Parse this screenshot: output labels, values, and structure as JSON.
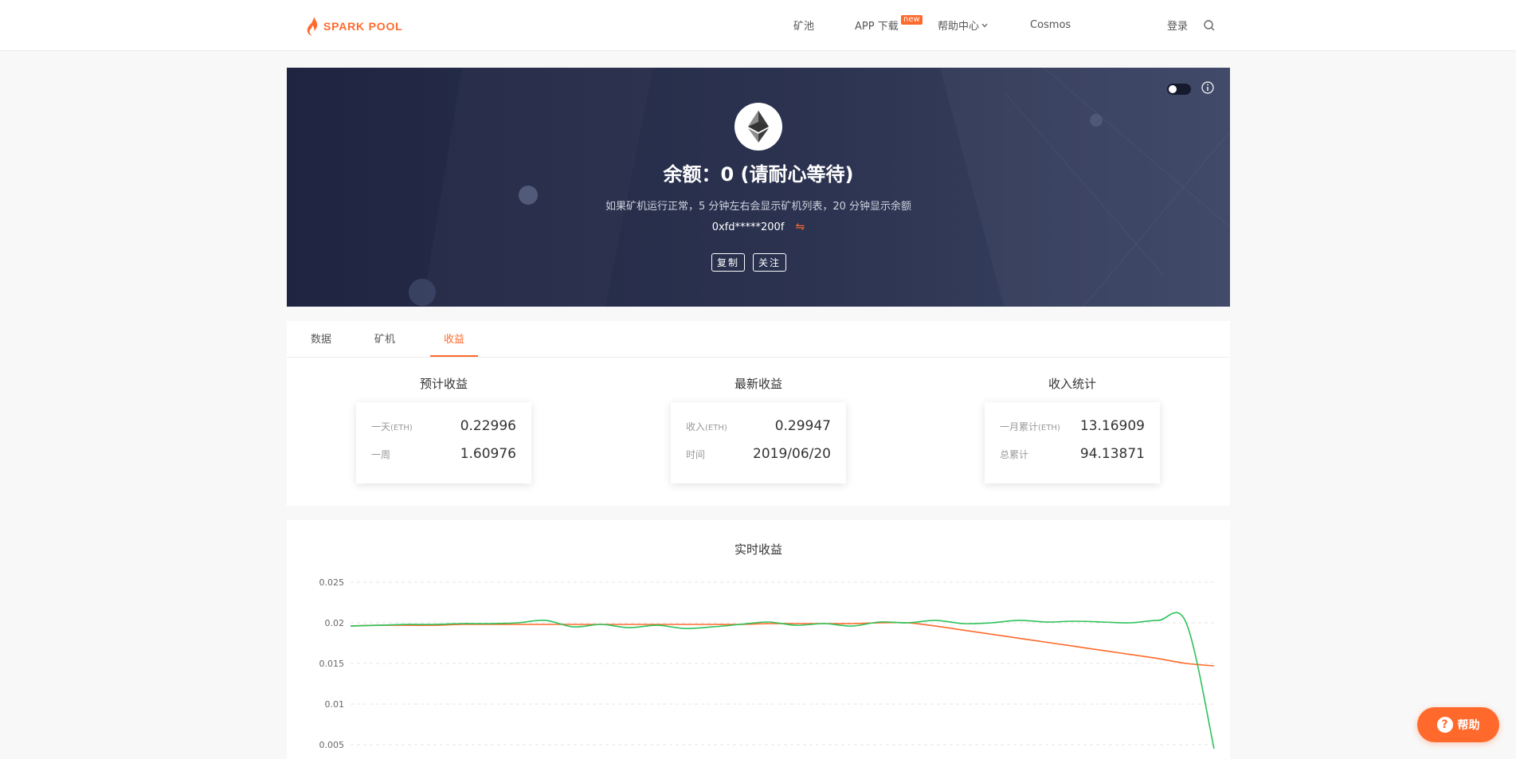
{
  "header": {
    "logo_text": "SPARK POOL",
    "nav": {
      "pool": "矿池",
      "app": "APP 下载",
      "app_badge": "new",
      "help": "帮助中心",
      "cosmos": "Cosmos",
      "login": "登录"
    }
  },
  "banner": {
    "balance": "余额：0 (请耐心等待)",
    "hint": "如果矿机运行正常，5 分钟左右会显示矿机列表，20 分钟显示余额",
    "address": "0xfd*****200f",
    "copy_button": "复制",
    "follow_button": "关注"
  },
  "tabs": [
    {
      "label": "数据"
    },
    {
      "label": "矿机"
    },
    {
      "label": "收益",
      "active": true
    }
  ],
  "stats": [
    {
      "title": "预计收益",
      "rows": [
        {
          "label": "一天",
          "unit": "(ETH)",
          "value": "0.22996"
        },
        {
          "label": "一周",
          "unit": "",
          "value": "1.60976"
        }
      ]
    },
    {
      "title": "最新收益",
      "rows": [
        {
          "label": "收入",
          "unit": "(ETH)",
          "value": "0.29947"
        },
        {
          "label": "时间",
          "unit": "",
          "value": "2019/06/20"
        }
      ]
    },
    {
      "title": "收入统计",
      "rows": [
        {
          "label": "一月累计",
          "unit": "(ETH)",
          "value": "13.16909"
        },
        {
          "label": "总累计",
          "unit": "",
          "value": "94.13871"
        }
      ]
    }
  ],
  "chart_data": {
    "type": "line",
    "title": "实时收益",
    "xlabel": "",
    "ylabel": "",
    "y_ticks": [
      0.005,
      0.01,
      0.015,
      0.02,
      0.025
    ],
    "y_tick_labels": [
      "0.005",
      "0.01",
      "0.015",
      "0.02",
      "0.025"
    ],
    "ylim": [
      0.005,
      0.025
    ],
    "grid": true,
    "series": [
      {
        "color": "#ff6a2c",
        "values": [
          0.0196,
          0.0197,
          0.0197,
          0.0197,
          0.0198,
          0.0198,
          0.0198,
          0.0198,
          0.0198,
          0.0198,
          0.0198,
          0.0198,
          0.0198,
          0.0198,
          0.0198,
          0.0199,
          0.0199,
          0.0199,
          0.0199,
          0.02,
          0.02,
          0.0196,
          0.0191,
          0.0186,
          0.0181,
          0.0176,
          0.0171,
          0.0166,
          0.0161,
          0.0156,
          0.015,
          0.0147
        ]
      },
      {
        "color": "#2ec25b",
        "values": [
          0.0196,
          0.0197,
          0.0198,
          0.0198,
          0.0199,
          0.0199,
          0.02,
          0.0203,
          0.0195,
          0.0198,
          0.0194,
          0.0197,
          0.0193,
          0.0195,
          0.0198,
          0.0201,
          0.0197,
          0.0199,
          0.0196,
          0.0201,
          0.02,
          0.0203,
          0.0199,
          0.02,
          0.0203,
          0.0201,
          0.0202,
          0.0201,
          0.02,
          0.0203,
          0.02,
          0.0045
        ]
      }
    ]
  },
  "help_button": {
    "label": "帮助",
    "icon_glyph": "?"
  }
}
